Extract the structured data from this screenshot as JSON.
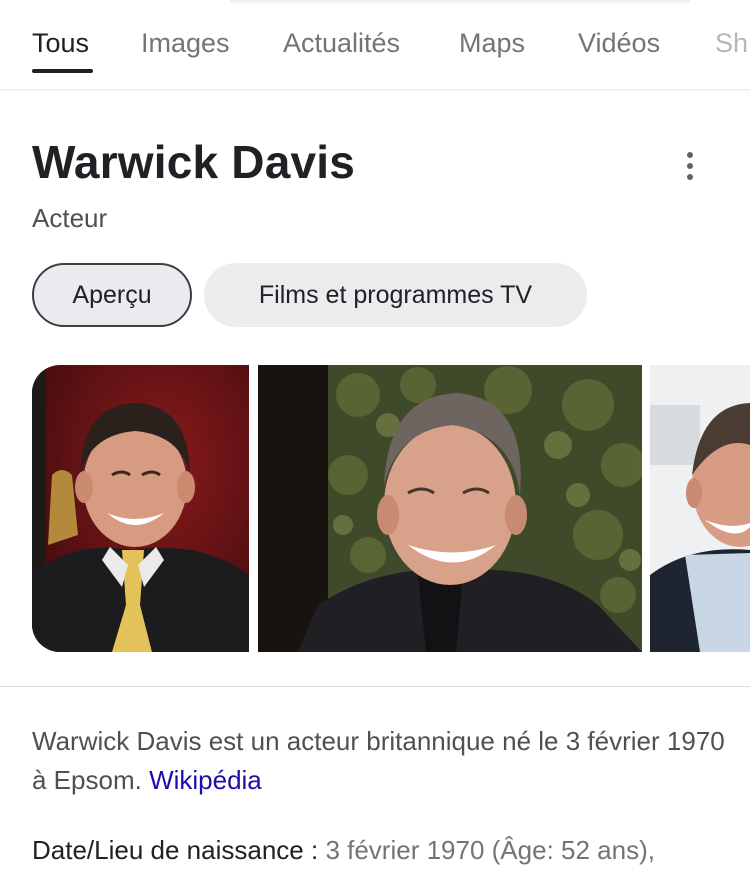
{
  "tabs": [
    {
      "label": "Tous",
      "active": true
    },
    {
      "label": "Images"
    },
    {
      "label": "Actualités"
    },
    {
      "label": "Maps"
    },
    {
      "label": "Vidéos"
    },
    {
      "label": "Sh"
    }
  ],
  "entity": {
    "name": "Warwick Davis",
    "subtitle": "Acteur"
  },
  "chips": [
    {
      "label": "Aperçu",
      "selected": true
    },
    {
      "label": "Films et programmes TV",
      "selected": false
    }
  ],
  "description": {
    "text": "Warwick Davis est un acteur britannique né le 3 février 1970 à Epsom.",
    "source_link": "Wikipédia"
  },
  "facts": [
    {
      "label": "Date/Lieu de naissance :",
      "value": "3 février 1970 (Âge: 52 ans),"
    }
  ],
  "colors": {
    "text_primary": "#202124",
    "text_secondary": "#70757a",
    "link": "#1a0dab",
    "chip_bg": "#ececef"
  }
}
